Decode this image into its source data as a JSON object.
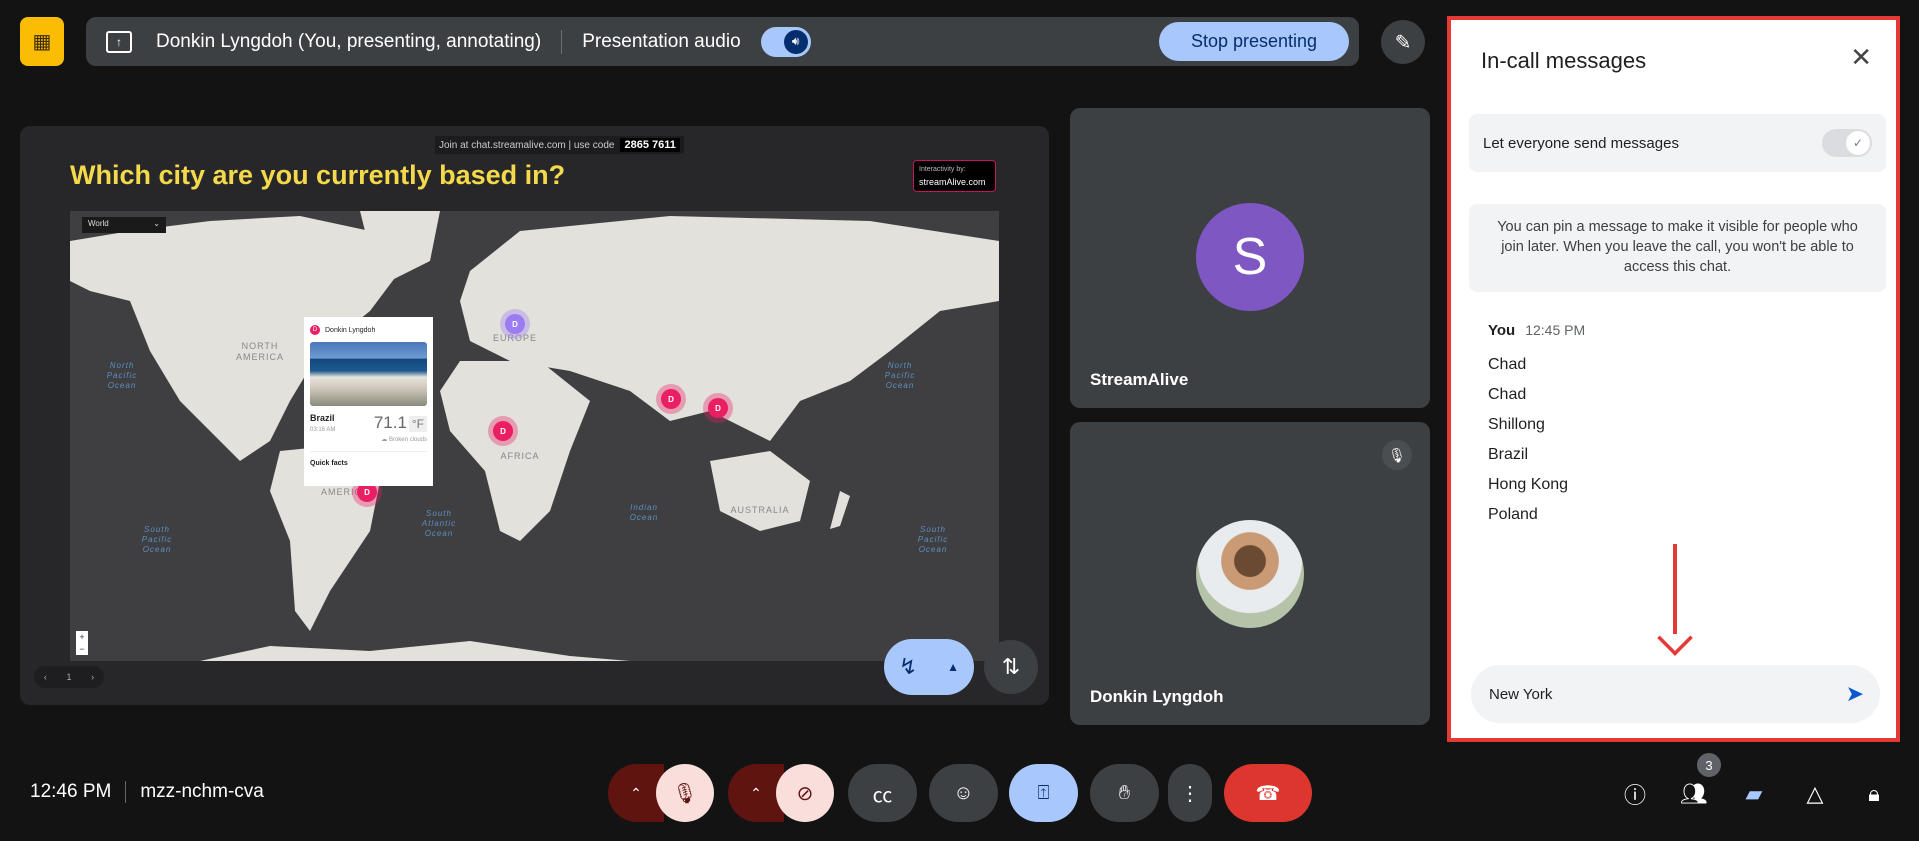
{
  "topbar": {
    "presenter": "Donkin Lyngdoh (You, presenting, annotating)",
    "audio_label": "Presentation audio",
    "audio_on": true,
    "stop_label": "Stop presenting"
  },
  "slide": {
    "join_text": "Join at chat.streamalive.com | use code",
    "code": "2865 7611",
    "title": "Which city are you currently based in?",
    "logo_small": "Interactivity by:",
    "logo_name": "streamAlive.com",
    "region_select": "World",
    "oceans": [
      "North Pacific Ocean",
      "North Pacific Ocean",
      "South Atlantic Ocean",
      "Indian Ocean",
      "South Pacific Ocean",
      "South Pacific Ocean"
    ],
    "continents": [
      "NORTH AMERICA",
      "AUSTRALIA",
      "EUROPE",
      "AFRICA",
      "AMERICA"
    ],
    "pin_label": "D",
    "popup": {
      "user": "Donkin Lyngdoh",
      "city": "Brazil",
      "time": "03:16 AM",
      "temp": "71.1",
      "unit": "°F",
      "weather": "Broken clouds",
      "quick_facts": "Quick facts"
    },
    "page": "1"
  },
  "tiles": [
    {
      "name": "StreamAlive",
      "initial": "S"
    },
    {
      "name": "Donkin Lyngdoh",
      "muted": true
    }
  ],
  "chat": {
    "title": "In-call messages",
    "toggle_label": "Let everyone send messages",
    "toggle_on": false,
    "info": "You can pin a message to make it visible for people who join later. When you leave the call, you won't be able to access this chat.",
    "sender": "You",
    "time": "12:45 PM",
    "messages": [
      "Chad",
      "Chad",
      "Shillong",
      "Brazil",
      "Hong Kong",
      "Poland"
    ],
    "input_value": "New York",
    "accent": "#e53935"
  },
  "bottom": {
    "time": "12:46 PM",
    "meeting_code": "mzz-nchm-cva",
    "people_count": "3"
  }
}
